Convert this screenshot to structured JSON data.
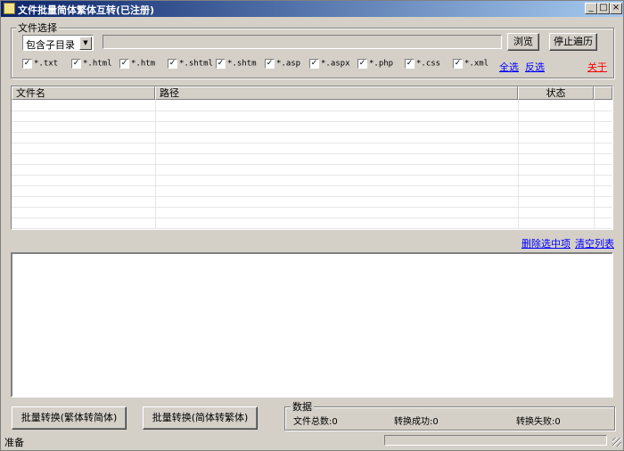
{
  "window": {
    "title": "文件批量简体繁体互转(已注册)",
    "controls": {
      "minimize": "_",
      "maximize": "□",
      "close": "×"
    }
  },
  "file_select": {
    "group_label": "文件选择",
    "subdir_option": "包含子目录",
    "path_value": "",
    "browse_label": "浏览",
    "stop_label": "停止遍历",
    "extensions": [
      {
        "label": "*.txt",
        "checked": true
      },
      {
        "label": "*.html",
        "checked": true
      },
      {
        "label": "*.htm",
        "checked": true
      },
      {
        "label": "*.shtml",
        "checked": true
      },
      {
        "label": "*.shtm",
        "checked": true
      },
      {
        "label": "*.asp",
        "checked": true
      },
      {
        "label": "*.aspx",
        "checked": true
      },
      {
        "label": "*.php",
        "checked": true
      },
      {
        "label": "*.css",
        "checked": true
      },
      {
        "label": "*.xml",
        "checked": true
      }
    ],
    "select_all": "全选",
    "invert": "反选",
    "about": "关于"
  },
  "file_list": {
    "columns": [
      "文件名",
      "路径",
      "状态"
    ],
    "rows": [],
    "delete_selected": "删除选中项",
    "clear_list": "清空列表"
  },
  "log": {
    "text": ""
  },
  "actions": {
    "trad_to_simp": "批量转换(繁体转简体)",
    "simp_to_trad": "批量转换(简体转繁体)"
  },
  "stats": {
    "group_label": "数据",
    "total_label": "文件总数:",
    "total_value": "0",
    "success_label": "转换成功:",
    "success_value": "0",
    "fail_label": "转换失败:",
    "fail_value": "0"
  },
  "status": {
    "text": "准备",
    "progress": 0
  }
}
